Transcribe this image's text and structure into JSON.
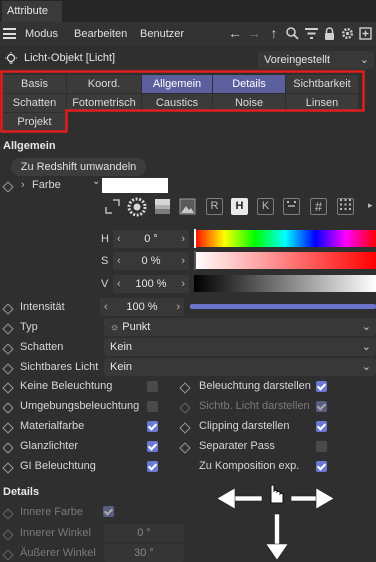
{
  "window": {
    "tab_title": "Attribute"
  },
  "menu": {
    "items": [
      "Modus",
      "Bearbeiten",
      "Benutzer"
    ]
  },
  "object": {
    "title": "Licht-Objekt [Licht]",
    "preset": "Voreingestellt"
  },
  "tabs": [
    {
      "label": "Basis",
      "active": false
    },
    {
      "label": "Koord.",
      "active": false
    },
    {
      "label": "Allgemein",
      "active": true
    },
    {
      "label": "Details",
      "active": true
    },
    {
      "label": "Sichtbarkeit",
      "active": false
    },
    {
      "label": "Schatten",
      "active": false
    },
    {
      "label": "Fotometrisch",
      "active": false
    },
    {
      "label": "Caustics",
      "active": false
    },
    {
      "label": "Noise",
      "active": false
    },
    {
      "label": "Linsen",
      "active": false
    },
    {
      "label": "Projekt",
      "active": false
    }
  ],
  "allgemein": {
    "title": "Allgemein",
    "redshift_button": "Zu Redshift umwandeln",
    "color_label": "Farbe",
    "hsv": {
      "h_label": "H",
      "h_value": "0 °",
      "s_label": "S",
      "s_value": "0 %",
      "v_label": "V",
      "v_value": "100 %"
    },
    "color_modes": [
      "H",
      "K",
      "#"
    ],
    "intensity": {
      "label": "Intensität",
      "value": "100 %",
      "level": 1.0
    },
    "type": {
      "label": "Typ",
      "value": "Punkt"
    },
    "shadow": {
      "label": "Schatten",
      "value": "Kein"
    },
    "visible_light": {
      "label": "Sichtbares Licht",
      "value": "Kein"
    }
  },
  "checkboxes_left": [
    {
      "label": "Keine Beleuchtung",
      "checked": false
    },
    {
      "label": "Umgebungsbeleuchtung",
      "checked": false
    },
    {
      "label": "Materialfarbe",
      "checked": true
    },
    {
      "label": "Glanzlichter",
      "checked": true
    },
    {
      "label": "GI Beleuchtung",
      "checked": true
    }
  ],
  "checkboxes_right": [
    {
      "label": "Beleuchtung darstellen",
      "checked": true,
      "disabled": false
    },
    {
      "label": "Sichtb. Licht darstellen",
      "checked": true,
      "disabled": true
    },
    {
      "label": "Clipping darstellen",
      "checked": true,
      "disabled": false
    },
    {
      "label": "Separater Pass",
      "checked": false,
      "disabled": false
    },
    {
      "label": "Zu Komposition exp.",
      "checked": true,
      "disabled": false
    }
  ],
  "details": {
    "title": "Details",
    "inner_color_label": "Innere Farbe",
    "inner_color_checked": true,
    "inner_angle": {
      "label": "Innerer Winkel",
      "value": "0 °"
    },
    "outer_angle": {
      "label": "Äußerer Winkel",
      "value": "30 °"
    }
  },
  "colors": {
    "accent": "#5b5f9d",
    "highlight_box": "#e01e1e",
    "checkbox_on": "#6b78d4"
  }
}
